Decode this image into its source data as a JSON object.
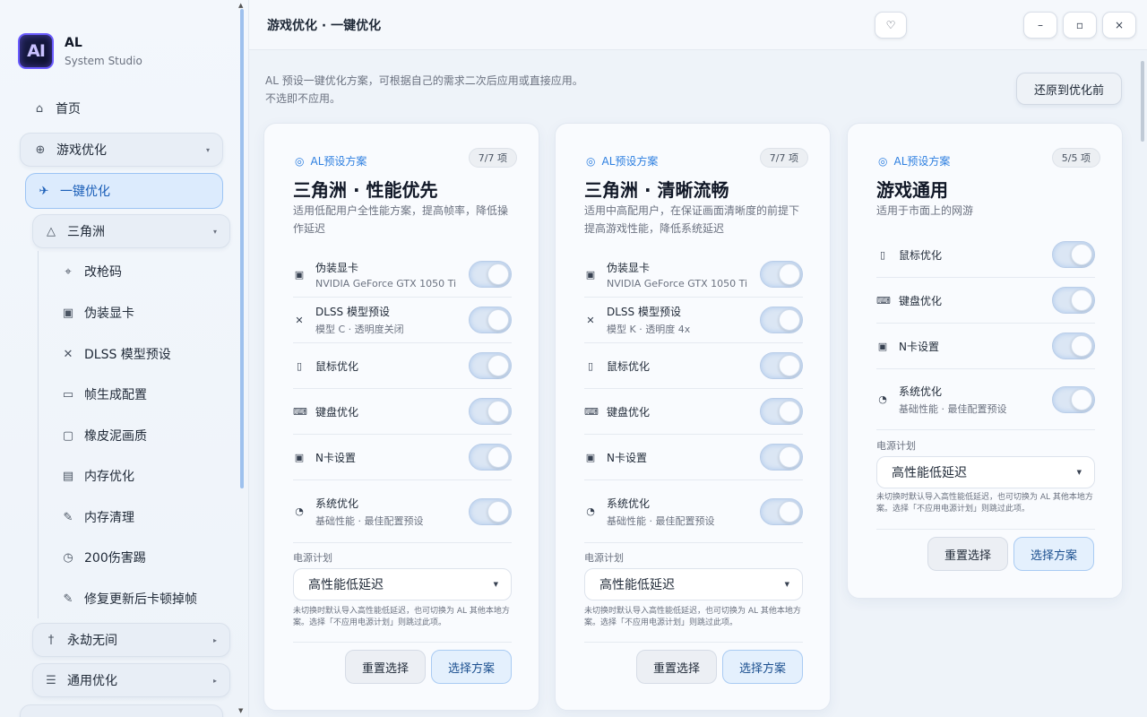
{
  "app": {
    "logo_text": "AI",
    "name": "AL",
    "subtitle": "System Studio"
  },
  "sidebar": {
    "home": "首页",
    "game_opt": "游戏优化",
    "one_click": "一键优化",
    "delta": "三角洲",
    "items": [
      "改枪码",
      "伪装显卡",
      "DLSS 模型预设",
      "帧生成配置",
      "橡皮泥画质",
      "内存优化",
      "内存清理",
      "200伤害踢",
      "修复更新后卡顿掉帧"
    ],
    "yongjie": "永劫无间",
    "general": "通用优化"
  },
  "header": {
    "title": "游戏优化 · 一键优化"
  },
  "window": {
    "min": "–",
    "max": "▫",
    "close": "×"
  },
  "intro": {
    "line1": "AL 预设一键优化方案，可根据自己的需求二次后应用或直接应用。",
    "line2": "不选即不应用。"
  },
  "restore_label": "还原到优化前",
  "power": {
    "label": "电源计划",
    "value": "高性能低延迟",
    "note": "未切换时默认导入高性能低延迟，也可切换为 AL 其他本地方案。选择「不应用电源计划」则跳过此项。"
  },
  "buttons": {
    "reset": "重置选择",
    "choose": "选择方案"
  },
  "cards": [
    {
      "tag": "AL预设方案",
      "count": "7/7 项",
      "title": "三角洲 · 性能优先",
      "desc": "适用低配用户全性能方案，提高帧率，降低操作延迟",
      "rows": [
        {
          "t1": "伪装显卡",
          "t2": "NVIDIA GeForce GTX 1050 Ti"
        },
        {
          "t1": "DLSS 模型预设",
          "t2": "模型 C · 透明度关闭"
        },
        {
          "t1": "鼠标优化",
          "t2": ""
        },
        {
          "t1": "键盘优化",
          "t2": ""
        },
        {
          "t1": "N卡设置",
          "t2": ""
        },
        {
          "t1": "系统优化",
          "t2": "基础性能 · 最佳配置预设"
        }
      ]
    },
    {
      "tag": "AL预设方案",
      "count": "7/7 项",
      "title": "三角洲 · 清晰流畅",
      "desc": "适用中高配用户，在保证画面清晰度的前提下提高游戏性能，降低系统延迟",
      "rows": [
        {
          "t1": "伪装显卡",
          "t2": "NVIDIA GeForce GTX 1050 Ti"
        },
        {
          "t1": "DLSS 模型预设",
          "t2": "模型 K · 透明度 4x"
        },
        {
          "t1": "鼠标优化",
          "t2": ""
        },
        {
          "t1": "键盘优化",
          "t2": ""
        },
        {
          "t1": "N卡设置",
          "t2": ""
        },
        {
          "t1": "系统优化",
          "t2": "基础性能 · 最佳配置预设"
        }
      ]
    },
    {
      "tag": "AL预设方案",
      "count": "5/5 项",
      "title": "游戏通用",
      "desc": "适用于市面上的网游",
      "rows": [
        {
          "t1": "鼠标优化",
          "t2": ""
        },
        {
          "t1": "键盘优化",
          "t2": ""
        },
        {
          "t1": "N卡设置",
          "t2": ""
        },
        {
          "t1": "系统优化",
          "t2": "基础性能 · 最佳配置预设"
        }
      ]
    }
  ]
}
